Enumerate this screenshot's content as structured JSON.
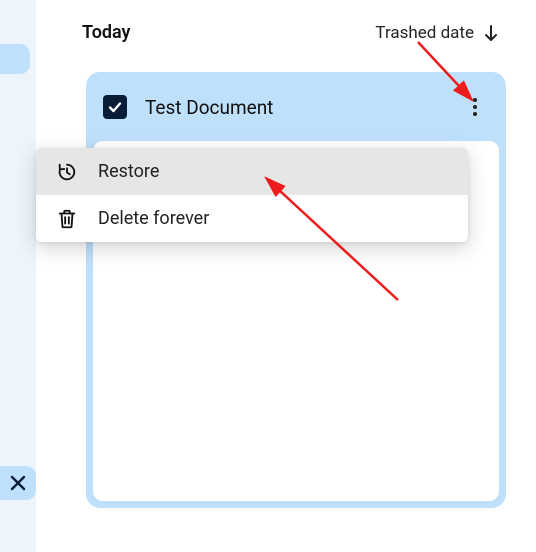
{
  "header": {
    "section_title": "Today",
    "sort_label": "Trashed date"
  },
  "document": {
    "title": "Test Document",
    "checked": true
  },
  "menu": {
    "items": [
      {
        "label": "Restore",
        "icon": "history-icon"
      },
      {
        "label": "Delete forever",
        "icon": "trash-icon"
      }
    ]
  }
}
